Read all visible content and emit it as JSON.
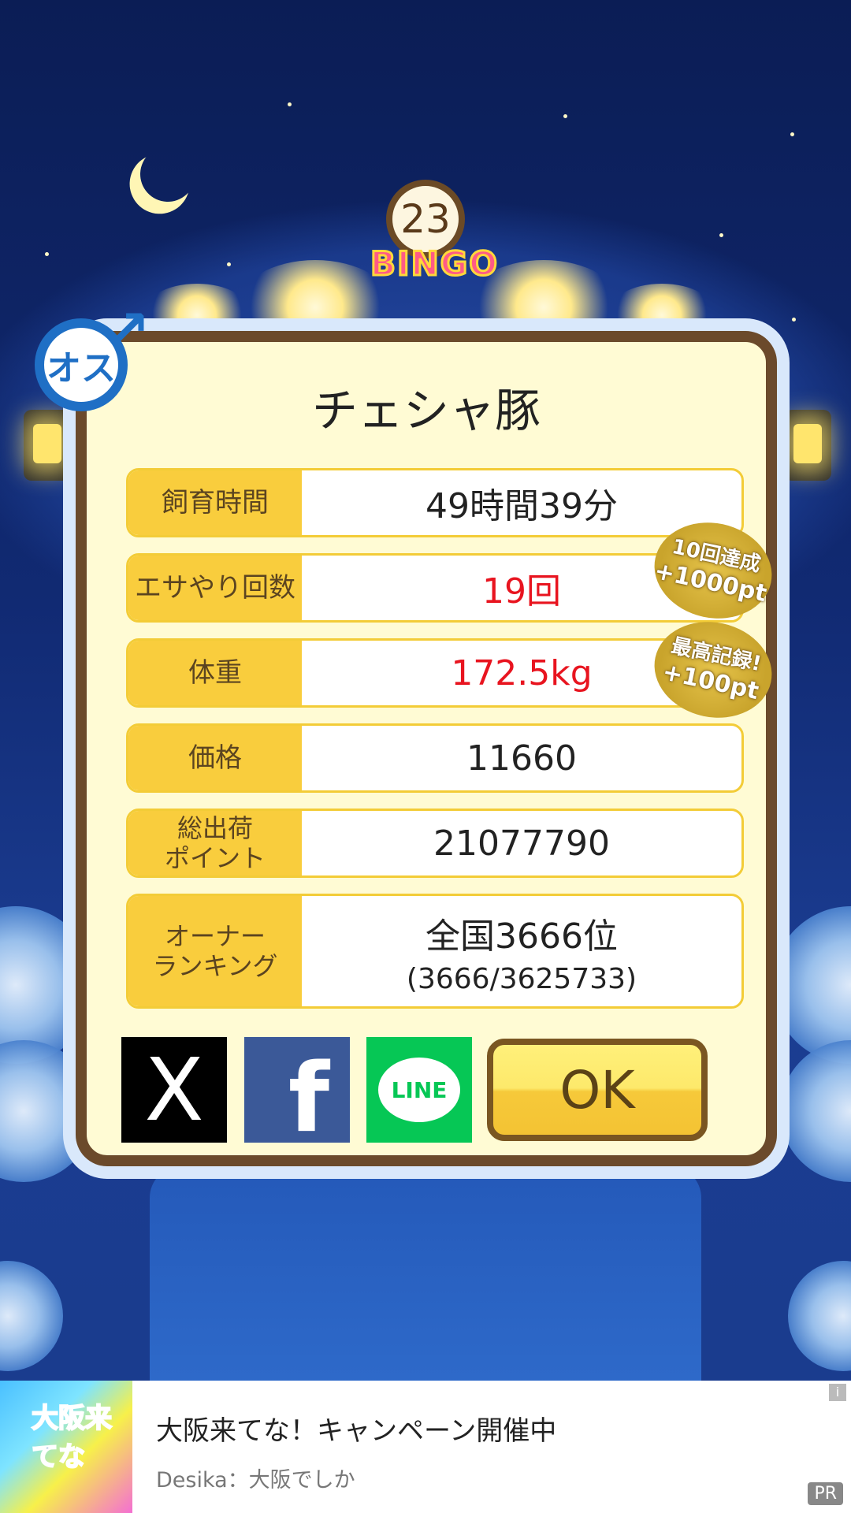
{
  "bingo": {
    "number": "23",
    "label": "BINGO"
  },
  "gender_badge": {
    "label": "オス"
  },
  "dialog": {
    "title": "チェシャ豚",
    "rows": [
      {
        "label": "飼育時間",
        "value": "49時間39分"
      },
      {
        "label": "エサやり回数",
        "value": "19回"
      },
      {
        "label": "体重",
        "value": "172.5kg"
      },
      {
        "label": "価格",
        "value": "11660"
      },
      {
        "label": "総出荷\nポイント",
        "value": "21077790"
      },
      {
        "label": "オーナー\nランキング",
        "value": "全国3666位",
        "sub": "(3666/3625733)"
      }
    ],
    "medals": [
      {
        "line1": "10回達成",
        "line2": "+1000pt"
      },
      {
        "line1": "最高記録!",
        "line2": "+100pt"
      }
    ],
    "social": {
      "x": "X",
      "facebook": "f",
      "line": "LINE"
    },
    "ok_label": "OK"
  },
  "ad": {
    "image_text": "大阪来てな",
    "title": "大阪来てな！キャンペーン開催中",
    "subtitle": "Desika：大阪でしか",
    "info": "i",
    "pr": "PR"
  }
}
